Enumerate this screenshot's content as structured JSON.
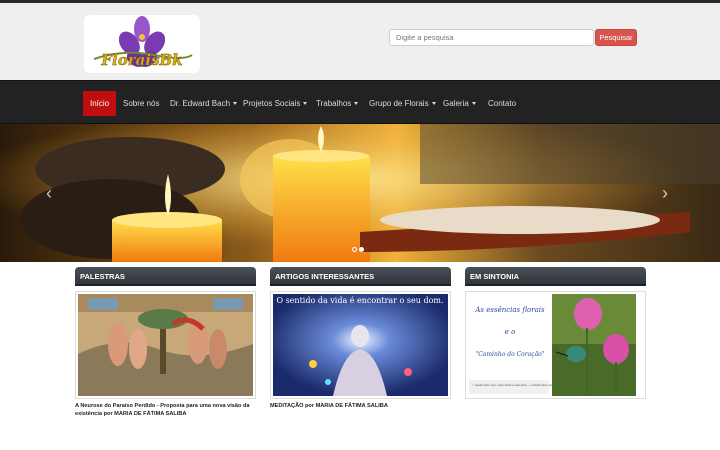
{
  "header": {
    "logo_text": "FloraisBk",
    "search": {
      "placeholder": "Digite a pesquisa",
      "button_label": "Pesquisar"
    }
  },
  "nav": {
    "items": [
      {
        "label": "Início",
        "active": true,
        "dropdown": false
      },
      {
        "label": "Sobre nós",
        "active": false,
        "dropdown": false
      },
      {
        "label": "Dr. Edward Bach",
        "active": false,
        "dropdown": true
      },
      {
        "label": "Projetos Sociais",
        "active": false,
        "dropdown": true
      },
      {
        "label": "Trabalhos",
        "active": false,
        "dropdown": true
      },
      {
        "label": "Grupo de Florais",
        "active": false,
        "dropdown": true
      },
      {
        "label": "Galeria",
        "active": false,
        "dropdown": true
      },
      {
        "label": "Contato",
        "active": false,
        "dropdown": false
      }
    ]
  },
  "slider": {
    "slide_count": 2,
    "active_index": 1,
    "prev_glyph": "‹",
    "next_glyph": "›"
  },
  "sections": [
    {
      "title": "PALESTRAS",
      "caption": "A Neurose do Paraíso Perdido - Proposta para uma nova visão da existência por MARIA DE FÁTIMA SALIBA"
    },
    {
      "title": "ARTIGOS INTERESSANTES",
      "image_text": "O sentido da vida é encontrar o seu dom.",
      "caption": "MEDITAÇÃO por MARIA DE FÁTIMA SALIBA"
    },
    {
      "title": "EM SINTONIA",
      "image_text_1": "As essências florais",
      "image_text_2": "e o",
      "image_text_3": "\"Caminho do Coração\"",
      "image_quote": "\"...aquiet nosso corpo, nossa mente e nossa alma... o caminho para o aperfeiçoamento\" - Edward Bach",
      "caption": ""
    }
  ],
  "colors": {
    "accent": "#c00d0d",
    "search_button": "#d9534f",
    "nav_bg": "#222222",
    "header_bg": "#efefef"
  }
}
